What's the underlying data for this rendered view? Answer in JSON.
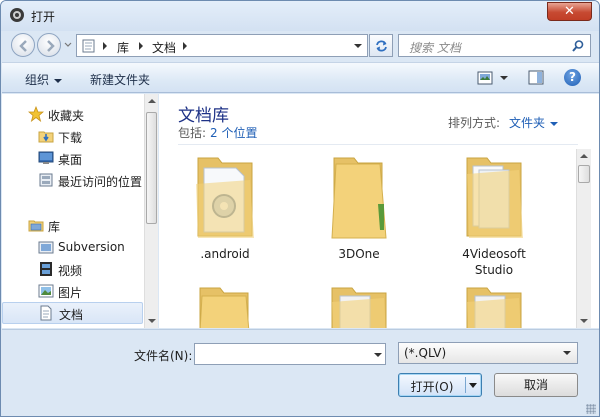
{
  "window": {
    "title": "打开",
    "close_symbol": "✕"
  },
  "address": {
    "crumbs": [
      "库",
      "文档"
    ],
    "search_placeholder": "搜索 文档"
  },
  "toolbar": {
    "organize_label": "组织",
    "new_folder_label": "新建文件夹",
    "help_symbol": "?"
  },
  "nav": {
    "favorites_label": "收藏夹",
    "favorites": [
      {
        "label": "下载",
        "icon": "download-folder-icon"
      },
      {
        "label": "桌面",
        "icon": "desktop-icon"
      },
      {
        "label": "最近访问的位置",
        "icon": "recent-places-icon"
      }
    ],
    "libraries_label": "库",
    "libraries": [
      {
        "label": "Subversion",
        "icon": "subversion-library-icon"
      },
      {
        "label": "视频",
        "icon": "videos-library-icon"
      },
      {
        "label": "图片",
        "icon": "pictures-library-icon"
      },
      {
        "label": "文档",
        "icon": "documents-library-icon",
        "selected": true
      }
    ]
  },
  "library": {
    "title": "文档库",
    "includes_label": "包括:",
    "includes_link": "2 个位置",
    "arrange_label": "排列方式:",
    "arrange_value": "文件夹"
  },
  "items": [
    {
      "name": ".android",
      "icon": "settings-folder-icon"
    },
    {
      "name": "3DOne",
      "icon": "folder-icon"
    },
    {
      "name": "4Videosoft Studio",
      "icon": "folder-with-files-icon"
    },
    {
      "name": "",
      "icon": "folder-icon"
    },
    {
      "name": "",
      "icon": "folder-with-files-icon"
    },
    {
      "name": "",
      "icon": "folder-with-files-icon"
    }
  ],
  "bottom": {
    "filename_label": "文件名(N):",
    "filename_value": "",
    "filter_value": "(*.QLV)",
    "open_label": "打开(O)",
    "cancel_label": "取消"
  },
  "colors": {
    "accent": "#1f5fb6",
    "title_blue": "#1e3287",
    "folder": "#f3d27a",
    "window_bg": "#dbe7f4"
  }
}
